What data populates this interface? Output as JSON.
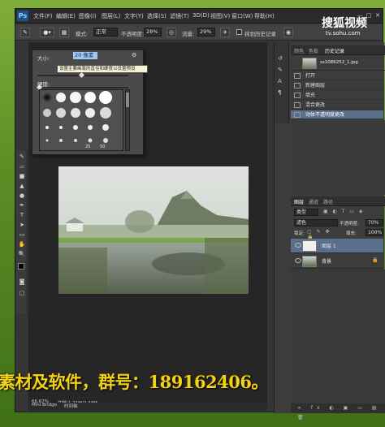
{
  "app": {
    "logo": "Ps",
    "menu": [
      "文件(F)",
      "编辑(E)",
      "图像(I)",
      "图层(L)",
      "文字(Y)",
      "选择(S)",
      "滤镜(T)",
      "3D(D)",
      "视图(V)",
      "窗口(W)",
      "帮助(H)"
    ],
    "window_controls": [
      "—",
      "□",
      "✕"
    ]
  },
  "options_bar": {
    "mode_label": "模式:",
    "mode_value": "正常",
    "opacity_label": "不透明度:",
    "opacity_value": "28%",
    "flow_label": "流量:",
    "flow_value": "29%",
    "history_label": "抹到历史记录"
  },
  "brush_popup": {
    "size_label": "大小:",
    "size_value": "20 像素",
    "tooltip": "设置主要画笔的直径和硬度以设置预设",
    "hardness_label": "硬度:",
    "numbers": [
      "25",
      "50"
    ]
  },
  "history_panel": {
    "tabs": [
      "颜色",
      "色板",
      "历史记录"
    ],
    "snapshot_name": "ss1086252_1.jpg",
    "rows": [
      "打开",
      "新建图层",
      "填充",
      "混合更改",
      "动体不透明度更改"
    ]
  },
  "layers_panel": {
    "tabs": [
      "图层",
      "通道",
      "路径"
    ],
    "filter": "类型",
    "blend_mode": "滤色",
    "opacity_label": "不透明度:",
    "opacity_value": "70%",
    "lock_label": "锁定:",
    "fill_label": "填充:",
    "fill_value": "100%",
    "layers": [
      {
        "name": "图层 1",
        "active": true
      },
      {
        "name": "背景",
        "active": false
      }
    ]
  },
  "status_bar": {
    "zoom": "66.67%",
    "doc_info": "文档:1.21M/2.43M"
  },
  "bottom_tabs": [
    "Mini Bridge",
    "时间轴"
  ],
  "watermark": {
    "logo": "搜狐视频",
    "url": "tv.sohu.com"
  },
  "subtitle": "素材及软件，群号：189162406。"
}
